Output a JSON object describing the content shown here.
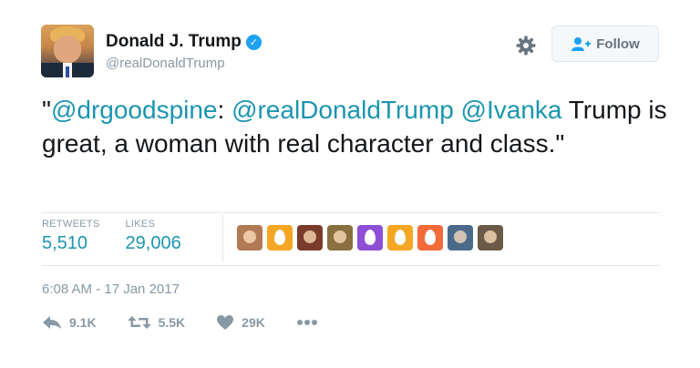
{
  "author": {
    "name": "Donald J. Trump",
    "handle": "@realDonaldTrump",
    "verified_mark": "✓"
  },
  "follow_button": {
    "label": "Follow",
    "icon": "add-user-icon"
  },
  "settings_icon": "gear-icon",
  "tweet": {
    "segments": [
      {
        "text": "\"",
        "type": "text"
      },
      {
        "text": "@drgoodspine",
        "type": "mention"
      },
      {
        "text": ": ",
        "type": "text"
      },
      {
        "text": "@realDonaldTrump",
        "type": "mention"
      },
      {
        "text": " ",
        "type": "text"
      },
      {
        "text": "@Ivanka",
        "type": "mention"
      },
      {
        "text": " Trump is great, a woman with real character and class.\"",
        "type": "text"
      }
    ]
  },
  "stats": {
    "retweets_label": "RETWEETS",
    "retweets_value": "5,510",
    "likes_label": "LIKES",
    "likes_value": "29,006"
  },
  "likers": [
    {
      "kind": "photo",
      "color": "#b07a54",
      "icon": "avatar-photo"
    },
    {
      "kind": "egg",
      "color": "#f5a623",
      "icon": "egg-avatar-icon"
    },
    {
      "kind": "photo",
      "color": "#7a3b2a",
      "icon": "avatar-photo"
    },
    {
      "kind": "photo",
      "color": "#8a7040",
      "icon": "avatar-photo"
    },
    {
      "kind": "egg",
      "color": "#8e4fd6",
      "icon": "egg-avatar-icon"
    },
    {
      "kind": "egg",
      "color": "#f5a623",
      "icon": "egg-avatar-icon"
    },
    {
      "kind": "egg",
      "color": "#f26b38",
      "icon": "egg-avatar-icon"
    },
    {
      "kind": "photo",
      "color": "#4a6a8a",
      "icon": "avatar-photo"
    },
    {
      "kind": "photo",
      "color": "#6b5a48",
      "icon": "avatar-photo"
    }
  ],
  "timestamp": "6:08 AM - 17 Jan 2017",
  "actions": {
    "reply_count": "9.1K",
    "retweet_count": "5.5K",
    "like_count": "29K",
    "reply_icon": "reply-icon",
    "retweet_icon": "retweet-icon",
    "like_icon": "heart-icon",
    "more_icon": "more-icon"
  },
  "colors": {
    "link": "#1b95b0",
    "muted": "#8899a6",
    "verified": "#1da1f2"
  }
}
